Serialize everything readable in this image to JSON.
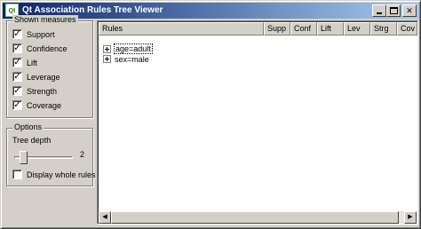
{
  "window": {
    "title": "Qt Association Rules Tree Viewer",
    "app_icon": "app-icon",
    "caption_buttons": [
      "minimize",
      "maximize",
      "close"
    ]
  },
  "measures": {
    "title": "Shown measures",
    "items": [
      {
        "label": "Support",
        "checked": true
      },
      {
        "label": "Confidence",
        "checked": true
      },
      {
        "label": "Lift",
        "checked": true
      },
      {
        "label": "Leverage",
        "checked": true
      },
      {
        "label": "Strength",
        "checked": true
      },
      {
        "label": "Coverage",
        "checked": true
      }
    ]
  },
  "options": {
    "title": "Options",
    "tree_depth_label": "Tree depth",
    "tree_depth_value": "2",
    "tree_depth_min": 1,
    "tree_depth_max": 10,
    "display_whole_rules_label": "Display whole rules",
    "display_whole_rules_checked": false
  },
  "tree": {
    "columns": [
      "Rules",
      "Supp",
      "Conf",
      "Lift",
      "Lev",
      "Strg",
      "Cov"
    ],
    "items": [
      {
        "label": "age=adult",
        "focused": true
      },
      {
        "label": "sex=male",
        "focused": false
      }
    ]
  },
  "colors": {
    "titlebar_start": "#0a246a",
    "titlebar_end": "#a6caf0",
    "face": "#d4d0c8"
  }
}
